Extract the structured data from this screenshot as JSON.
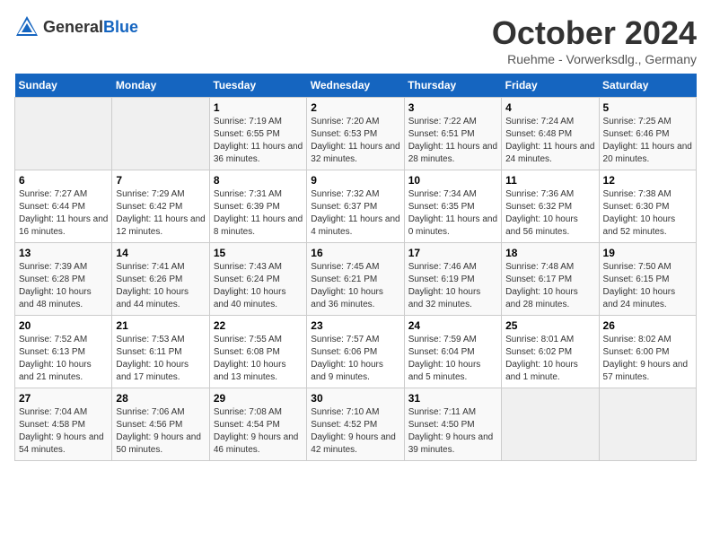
{
  "header": {
    "logo_general": "General",
    "logo_blue": "Blue",
    "title": "October 2024",
    "subtitle": "Ruehme - Vorwerksdlg., Germany"
  },
  "days_of_week": [
    "Sunday",
    "Monday",
    "Tuesday",
    "Wednesday",
    "Thursday",
    "Friday",
    "Saturday"
  ],
  "weeks": [
    [
      {
        "day": "",
        "sunrise": "",
        "sunset": "",
        "daylight": ""
      },
      {
        "day": "",
        "sunrise": "",
        "sunset": "",
        "daylight": ""
      },
      {
        "day": "1",
        "sunrise": "Sunrise: 7:19 AM",
        "sunset": "Sunset: 6:55 PM",
        "daylight": "Daylight: 11 hours and 36 minutes."
      },
      {
        "day": "2",
        "sunrise": "Sunrise: 7:20 AM",
        "sunset": "Sunset: 6:53 PM",
        "daylight": "Daylight: 11 hours and 32 minutes."
      },
      {
        "day": "3",
        "sunrise": "Sunrise: 7:22 AM",
        "sunset": "Sunset: 6:51 PM",
        "daylight": "Daylight: 11 hours and 28 minutes."
      },
      {
        "day": "4",
        "sunrise": "Sunrise: 7:24 AM",
        "sunset": "Sunset: 6:48 PM",
        "daylight": "Daylight: 11 hours and 24 minutes."
      },
      {
        "day": "5",
        "sunrise": "Sunrise: 7:25 AM",
        "sunset": "Sunset: 6:46 PM",
        "daylight": "Daylight: 11 hours and 20 minutes."
      }
    ],
    [
      {
        "day": "6",
        "sunrise": "Sunrise: 7:27 AM",
        "sunset": "Sunset: 6:44 PM",
        "daylight": "Daylight: 11 hours and 16 minutes."
      },
      {
        "day": "7",
        "sunrise": "Sunrise: 7:29 AM",
        "sunset": "Sunset: 6:42 PM",
        "daylight": "Daylight: 11 hours and 12 minutes."
      },
      {
        "day": "8",
        "sunrise": "Sunrise: 7:31 AM",
        "sunset": "Sunset: 6:39 PM",
        "daylight": "Daylight: 11 hours and 8 minutes."
      },
      {
        "day": "9",
        "sunrise": "Sunrise: 7:32 AM",
        "sunset": "Sunset: 6:37 PM",
        "daylight": "Daylight: 11 hours and 4 minutes."
      },
      {
        "day": "10",
        "sunrise": "Sunrise: 7:34 AM",
        "sunset": "Sunset: 6:35 PM",
        "daylight": "Daylight: 11 hours and 0 minutes."
      },
      {
        "day": "11",
        "sunrise": "Sunrise: 7:36 AM",
        "sunset": "Sunset: 6:32 PM",
        "daylight": "Daylight: 10 hours and 56 minutes."
      },
      {
        "day": "12",
        "sunrise": "Sunrise: 7:38 AM",
        "sunset": "Sunset: 6:30 PM",
        "daylight": "Daylight: 10 hours and 52 minutes."
      }
    ],
    [
      {
        "day": "13",
        "sunrise": "Sunrise: 7:39 AM",
        "sunset": "Sunset: 6:28 PM",
        "daylight": "Daylight: 10 hours and 48 minutes."
      },
      {
        "day": "14",
        "sunrise": "Sunrise: 7:41 AM",
        "sunset": "Sunset: 6:26 PM",
        "daylight": "Daylight: 10 hours and 44 minutes."
      },
      {
        "day": "15",
        "sunrise": "Sunrise: 7:43 AM",
        "sunset": "Sunset: 6:24 PM",
        "daylight": "Daylight: 10 hours and 40 minutes."
      },
      {
        "day": "16",
        "sunrise": "Sunrise: 7:45 AM",
        "sunset": "Sunset: 6:21 PM",
        "daylight": "Daylight: 10 hours and 36 minutes."
      },
      {
        "day": "17",
        "sunrise": "Sunrise: 7:46 AM",
        "sunset": "Sunset: 6:19 PM",
        "daylight": "Daylight: 10 hours and 32 minutes."
      },
      {
        "day": "18",
        "sunrise": "Sunrise: 7:48 AM",
        "sunset": "Sunset: 6:17 PM",
        "daylight": "Daylight: 10 hours and 28 minutes."
      },
      {
        "day": "19",
        "sunrise": "Sunrise: 7:50 AM",
        "sunset": "Sunset: 6:15 PM",
        "daylight": "Daylight: 10 hours and 24 minutes."
      }
    ],
    [
      {
        "day": "20",
        "sunrise": "Sunrise: 7:52 AM",
        "sunset": "Sunset: 6:13 PM",
        "daylight": "Daylight: 10 hours and 21 minutes."
      },
      {
        "day": "21",
        "sunrise": "Sunrise: 7:53 AM",
        "sunset": "Sunset: 6:11 PM",
        "daylight": "Daylight: 10 hours and 17 minutes."
      },
      {
        "day": "22",
        "sunrise": "Sunrise: 7:55 AM",
        "sunset": "Sunset: 6:08 PM",
        "daylight": "Daylight: 10 hours and 13 minutes."
      },
      {
        "day": "23",
        "sunrise": "Sunrise: 7:57 AM",
        "sunset": "Sunset: 6:06 PM",
        "daylight": "Daylight: 10 hours and 9 minutes."
      },
      {
        "day": "24",
        "sunrise": "Sunrise: 7:59 AM",
        "sunset": "Sunset: 6:04 PM",
        "daylight": "Daylight: 10 hours and 5 minutes."
      },
      {
        "day": "25",
        "sunrise": "Sunrise: 8:01 AM",
        "sunset": "Sunset: 6:02 PM",
        "daylight": "Daylight: 10 hours and 1 minute."
      },
      {
        "day": "26",
        "sunrise": "Sunrise: 8:02 AM",
        "sunset": "Sunset: 6:00 PM",
        "daylight": "Daylight: 9 hours and 57 minutes."
      }
    ],
    [
      {
        "day": "27",
        "sunrise": "Sunrise: 7:04 AM",
        "sunset": "Sunset: 4:58 PM",
        "daylight": "Daylight: 9 hours and 54 minutes."
      },
      {
        "day": "28",
        "sunrise": "Sunrise: 7:06 AM",
        "sunset": "Sunset: 4:56 PM",
        "daylight": "Daylight: 9 hours and 50 minutes."
      },
      {
        "day": "29",
        "sunrise": "Sunrise: 7:08 AM",
        "sunset": "Sunset: 4:54 PM",
        "daylight": "Daylight: 9 hours and 46 minutes."
      },
      {
        "day": "30",
        "sunrise": "Sunrise: 7:10 AM",
        "sunset": "Sunset: 4:52 PM",
        "daylight": "Daylight: 9 hours and 42 minutes."
      },
      {
        "day": "31",
        "sunrise": "Sunrise: 7:11 AM",
        "sunset": "Sunset: 4:50 PM",
        "daylight": "Daylight: 9 hours and 39 minutes."
      },
      {
        "day": "",
        "sunrise": "",
        "sunset": "",
        "daylight": ""
      },
      {
        "day": "",
        "sunrise": "",
        "sunset": "",
        "daylight": ""
      }
    ]
  ]
}
